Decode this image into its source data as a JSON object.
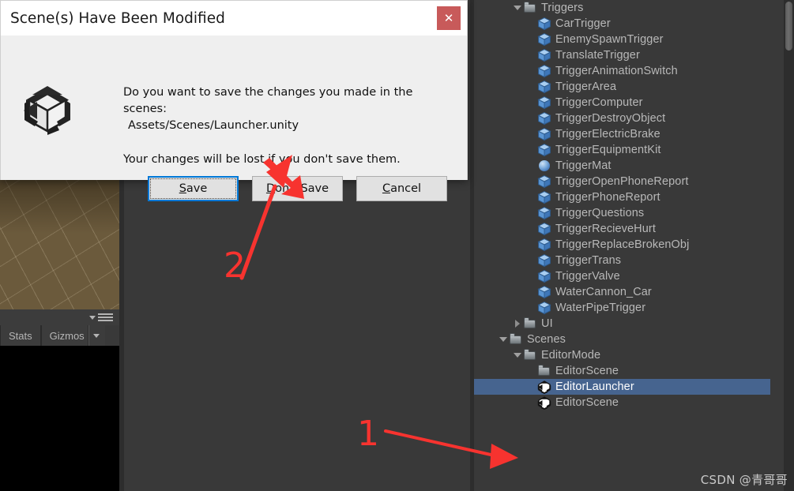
{
  "dialog": {
    "title": "Scene(s) Have Been Modified",
    "close_label": "✕",
    "logo_name": "unity-logo",
    "message_line1": "Do you want to save the changes you made in the",
    "message_line2": "scenes:",
    "scene_path": "Assets/Scenes/Launcher.unity",
    "warning": "Your changes will be lost if you don't save them.",
    "buttons": [
      {
        "label": "Save",
        "accel": "S",
        "focused": true
      },
      {
        "label": "Don't Save",
        "accel": "D",
        "focused": false
      },
      {
        "label": "Cancel",
        "accel": "C",
        "focused": false
      }
    ]
  },
  "scene_view": {
    "menu_icon": "hamburger-menu-icon",
    "tabs": [
      {
        "label": "Stats"
      },
      {
        "label": "Gizmos"
      }
    ]
  },
  "hierarchy": {
    "rows": [
      {
        "label": "Triggers",
        "icon": "folder",
        "indent": 1,
        "twisty": "down",
        "selected": false
      },
      {
        "label": "CarTrigger",
        "icon": "cube",
        "indent": 2,
        "twisty": "none",
        "selected": false
      },
      {
        "label": "EnemySpawnTrigger",
        "icon": "cube",
        "indent": 2,
        "twisty": "none",
        "selected": false
      },
      {
        "label": "TranslateTrigger",
        "icon": "cube",
        "indent": 2,
        "twisty": "none",
        "selected": false
      },
      {
        "label": "TriggerAnimationSwitch",
        "icon": "cube",
        "indent": 2,
        "twisty": "none",
        "selected": false
      },
      {
        "label": "TriggerArea",
        "icon": "cube",
        "indent": 2,
        "twisty": "none",
        "selected": false
      },
      {
        "label": "TriggerComputer",
        "icon": "cube",
        "indent": 2,
        "twisty": "none",
        "selected": false
      },
      {
        "label": "TriggerDestroyObject",
        "icon": "cube",
        "indent": 2,
        "twisty": "none",
        "selected": false
      },
      {
        "label": "TriggerElectricBrake",
        "icon": "cube",
        "indent": 2,
        "twisty": "none",
        "selected": false
      },
      {
        "label": "TriggerEquipmentKit",
        "icon": "cube",
        "indent": 2,
        "twisty": "none",
        "selected": false
      },
      {
        "label": "TriggerMat",
        "icon": "sphere",
        "indent": 2,
        "twisty": "none",
        "selected": false
      },
      {
        "label": "TriggerOpenPhoneReport",
        "icon": "cube",
        "indent": 2,
        "twisty": "none",
        "selected": false
      },
      {
        "label": "TriggerPhoneReport",
        "icon": "cube",
        "indent": 2,
        "twisty": "none",
        "selected": false
      },
      {
        "label": "TriggerQuestions",
        "icon": "cube",
        "indent": 2,
        "twisty": "none",
        "selected": false
      },
      {
        "label": "TriggerRecieveHurt",
        "icon": "cube",
        "indent": 2,
        "twisty": "none",
        "selected": false
      },
      {
        "label": "TriggerReplaceBrokenObj",
        "icon": "cube",
        "indent": 2,
        "twisty": "none",
        "selected": false
      },
      {
        "label": "TriggerTrans",
        "icon": "cube",
        "indent": 2,
        "twisty": "none",
        "selected": false
      },
      {
        "label": "TriggerValve",
        "icon": "cube",
        "indent": 2,
        "twisty": "none",
        "selected": false
      },
      {
        "label": "WaterCannon_Car",
        "icon": "cube",
        "indent": 2,
        "twisty": "none",
        "selected": false
      },
      {
        "label": "WaterPipeTrigger",
        "icon": "cube",
        "indent": 2,
        "twisty": "none",
        "selected": false
      },
      {
        "label": "UI",
        "icon": "folder",
        "indent": 1,
        "twisty": "right",
        "selected": false
      },
      {
        "label": "Scenes",
        "icon": "folder",
        "indent": 0,
        "twisty": "down",
        "selected": false
      },
      {
        "label": "EditorMode",
        "icon": "folder",
        "indent": 1,
        "twisty": "down",
        "selected": false
      },
      {
        "label": "EditorScene",
        "icon": "folder",
        "indent": 2,
        "twisty": "none",
        "selected": false
      },
      {
        "label": "EditorLauncher",
        "icon": "unity",
        "indent": 2,
        "twisty": "none",
        "selected": true
      },
      {
        "label": "EditorScene",
        "icon": "unity",
        "indent": 2,
        "twisty": "none",
        "selected": false
      }
    ]
  },
  "annotations": [
    {
      "number": "1"
    },
    {
      "number": "2"
    }
  ],
  "watermark": "CSDN @青哥哥",
  "colors": {
    "selection_blue": "#46648f",
    "annotation_red": "#f7332f",
    "close_red": "#c85a5a",
    "focus_blue": "#0078d7",
    "panel_bg": "#393939",
    "scene_ground": "#6b5a3c"
  }
}
